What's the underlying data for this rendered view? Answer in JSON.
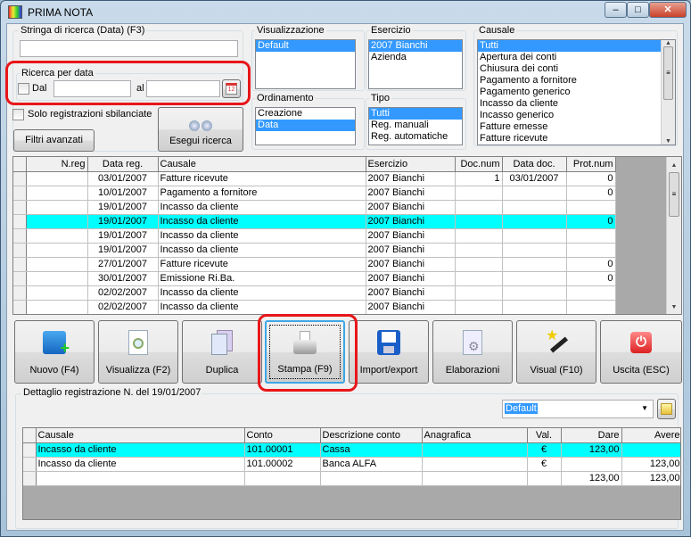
{
  "window": {
    "title": "PRIMA NOTA",
    "minimize": "–",
    "maximize": "□",
    "close": "✕"
  },
  "search": {
    "label": "Stringa di ricerca (Data) (F3)",
    "value": "",
    "date_group": "Ricerca per data",
    "dal_label": "Dal",
    "al_label": "al",
    "dal_value": "",
    "al_value": "",
    "only_unbalanced": "Solo registrazioni sbilanciate",
    "advanced_filters": "Filtri avanzati",
    "run_search": "Esegui ricerca"
  },
  "visualizzazione": {
    "label": "Visualizzazione",
    "items": [
      "Default"
    ],
    "selected": "Default"
  },
  "ordinamento": {
    "label": "Ordinamento",
    "items": [
      "Creazione",
      "Data"
    ],
    "selected": "Data"
  },
  "esercizio": {
    "label": "Esercizio",
    "items": [
      "2007 Bianchi",
      "Azienda"
    ],
    "selected": "2007 Bianchi"
  },
  "tipo": {
    "label": "Tipo",
    "items": [
      "Tutti",
      "Reg. manuali",
      "Reg. automatiche"
    ],
    "selected": "Tutti"
  },
  "causale": {
    "label": "Causale",
    "items": [
      "Tutti",
      "Apertura dei conti",
      "Chiusura dei conti",
      "Pagamento a fornitore",
      "Pagamento generico",
      "Incasso da cliente",
      "Incasso generico",
      "Fatture emesse",
      "Fatture ricevute"
    ],
    "selected": "Tutti"
  },
  "grid": {
    "columns": [
      "N.reg",
      "Data reg.",
      "Causale",
      "Esercizio",
      "Doc.num",
      "Data doc.",
      "Prot.num"
    ],
    "rows": [
      [
        "",
        "03/01/2007",
        "Fatture ricevute",
        "2007 Bianchi",
        "1",
        "03/01/2007",
        "0"
      ],
      [
        "",
        "10/01/2007",
        "Pagamento a fornitore",
        "2007 Bianchi",
        "",
        "",
        "0"
      ],
      [
        "",
        "19/01/2007",
        "Incasso da cliente",
        "2007 Bianchi",
        "",
        "",
        ""
      ],
      [
        "",
        "19/01/2007",
        "Incasso da cliente",
        "2007 Bianchi",
        "",
        "",
        "0"
      ],
      [
        "",
        "19/01/2007",
        "Incasso da cliente",
        "2007 Bianchi",
        "",
        "",
        ""
      ],
      [
        "",
        "19/01/2007",
        "Incasso da cliente",
        "2007 Bianchi",
        "",
        "",
        ""
      ],
      [
        "",
        "27/01/2007",
        "Fatture ricevute",
        "2007 Bianchi",
        "",
        "",
        "0"
      ],
      [
        "",
        "30/01/2007",
        "Emissione Ri.Ba.",
        "2007 Bianchi",
        "",
        "",
        "0"
      ],
      [
        "",
        "02/02/2007",
        "Incasso da cliente",
        "2007 Bianchi",
        "",
        "",
        ""
      ],
      [
        "",
        "02/02/2007",
        "Incasso da cliente",
        "2007 Bianchi",
        "",
        "",
        ""
      ]
    ],
    "selected_row": 3,
    "highlight_color": "#00ffff"
  },
  "toolbar": [
    {
      "label": "Nuovo (F4)",
      "icon": "new-record-icon"
    },
    {
      "label": "Visualizza (F2)",
      "icon": "view-document-icon"
    },
    {
      "label": "Duplica",
      "icon": "duplicate-icon"
    },
    {
      "label": "Stampa (F9)",
      "icon": "printer-icon"
    },
    {
      "label": "Import/export",
      "icon": "floppy-disk-icon"
    },
    {
      "label": "Elaborazioni",
      "icon": "gear-document-icon"
    },
    {
      "label": "Visual (F10)",
      "icon": "magic-wand-icon"
    },
    {
      "label": "Uscita (ESC)",
      "icon": "power-icon"
    }
  ],
  "detail": {
    "label": "Dettaglio registrazione N.  del 19/01/2007",
    "view_select": "Default",
    "columns": [
      "Causale",
      "Conto",
      "Descrizione conto",
      "Anagrafica",
      "Val.",
      "Dare",
      "Avere"
    ],
    "rows": [
      [
        "Incasso da cliente",
        "101.00001",
        "Cassa",
        "",
        "€",
        "123,00",
        ""
      ],
      [
        "Incasso da cliente",
        "101.00002",
        "Banca ALFA",
        "",
        "€",
        "",
        "123,00"
      ],
      [
        "",
        "",
        "",
        "",
        "",
        "123,00",
        "123,00"
      ]
    ],
    "selected_row": 0
  },
  "annotation_color": "#e8161a"
}
